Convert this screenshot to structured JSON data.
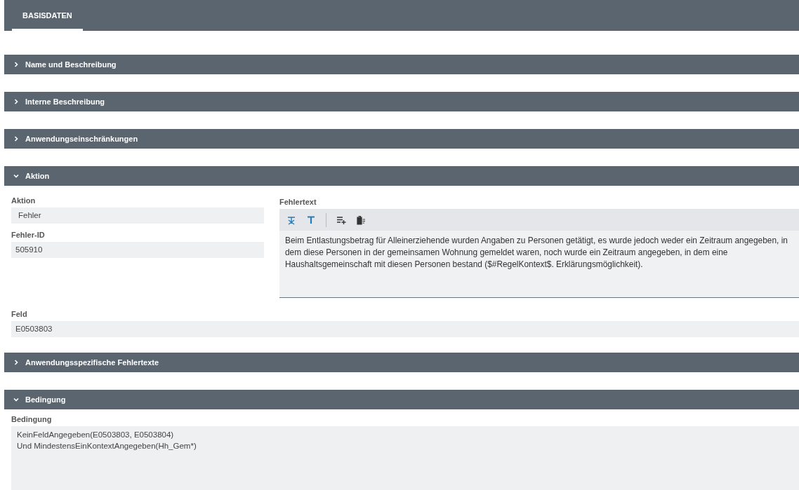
{
  "tabs": [
    {
      "label": "BASISDATEN",
      "selected": true
    }
  ],
  "sections": [
    {
      "title": "Name und Beschreibung",
      "expanded": false
    },
    {
      "title": "Interne Beschreibung",
      "expanded": false
    },
    {
      "title": "Anwendungseinschränkungen",
      "expanded": false
    },
    {
      "kind": "aktion",
      "title": "Aktion",
      "expanded": true,
      "aktion": {
        "label": "Aktion",
        "value": "Fehler"
      },
      "fehler_id": {
        "label": "Fehler-ID",
        "value": "505910"
      },
      "fehlertext": {
        "label": "Fehlertext",
        "toolbar": [
          {
            "kind": "clear"
          },
          {
            "kind": "text"
          },
          {
            "kind": "separator"
          },
          {
            "kind": "add-lines"
          },
          {
            "kind": "delete"
          }
        ],
        "value": "Beim Entlastungsbetrag für Alleinerziehende wurden Angaben zu Personen getätigt, es wurde jedoch weder ein Zeitraum angegeben, in dem diese Personen in der gemeinsamen Wohnung gemeldet waren, noch wurde ein Zeitraum angegeben, in dem eine Haushaltsgemeinschaft mit diesen Personen bestand ($#RegelKontext$. Erklärungsmöglichkeit)."
      },
      "feld": {
        "label": "Feld",
        "value": "E0503803"
      }
    },
    {
      "title": "Anwendungsspezifische Fehlertexte",
      "expanded": false
    },
    {
      "kind": "bedingung",
      "title": "Bedingung",
      "expanded": true,
      "bedingung": {
        "label": "Bedingung",
        "lines": [
          "KeinFeldAngegeben(E0503803, E0503804)",
          "Und MindestensEinKontextAngegeben(Hh_Gem*)"
        ]
      }
    }
  ]
}
